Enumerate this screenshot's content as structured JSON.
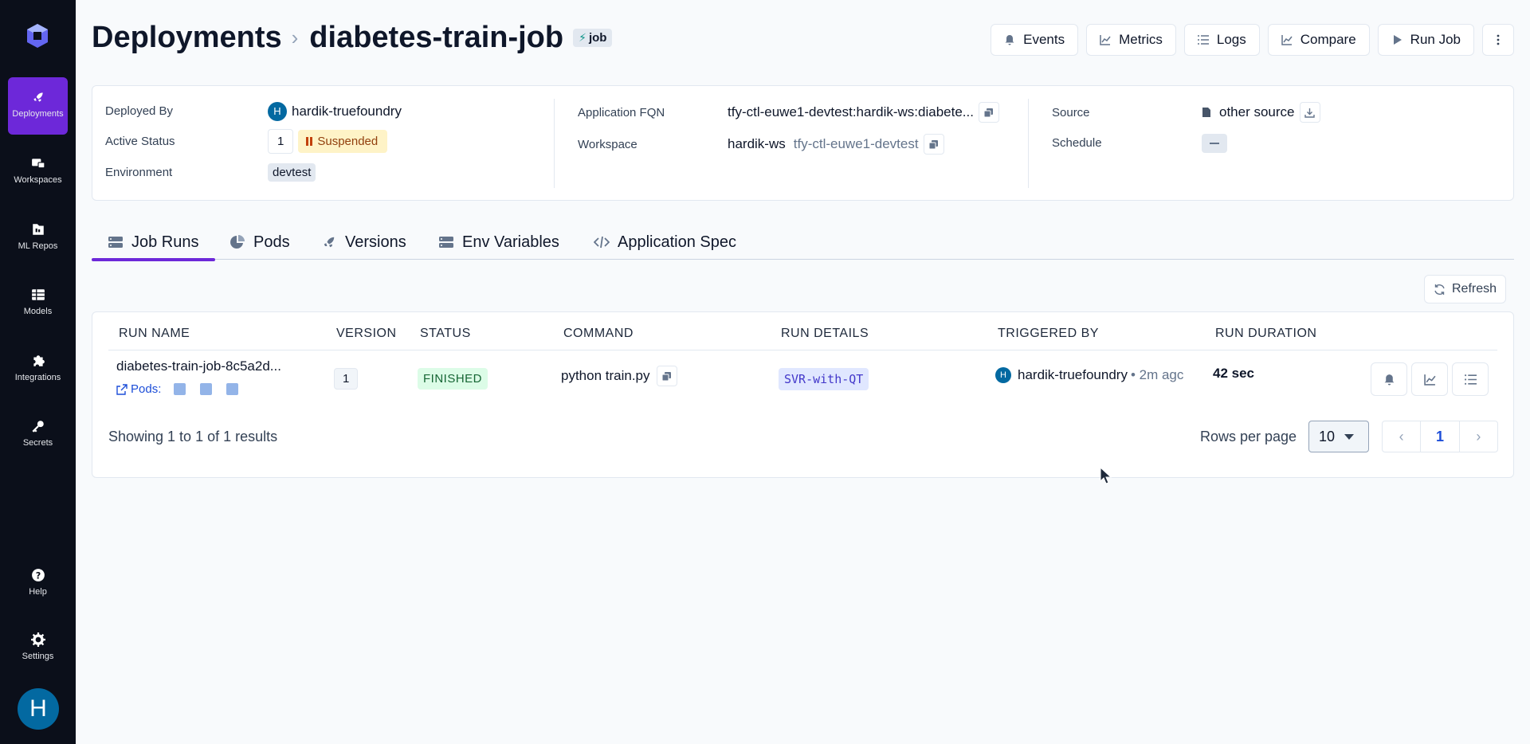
{
  "sidebar": {
    "items": [
      {
        "label": "Deployments",
        "icon": "rocket-icon"
      },
      {
        "label": "Workspaces",
        "icon": "workspaces-icon"
      },
      {
        "label": "ML Repos",
        "icon": "ml-repos-icon"
      },
      {
        "label": "Models",
        "icon": "models-icon"
      },
      {
        "label": "Integrations",
        "icon": "puzzle-icon"
      },
      {
        "label": "Secrets",
        "icon": "key-icon"
      },
      {
        "label": "Help",
        "icon": "help-icon"
      },
      {
        "label": "Settings",
        "icon": "gear-icon"
      }
    ],
    "avatar_initial": "H"
  },
  "header": {
    "breadcrumb_root": "Deployments",
    "breadcrumb_current": "diabetes-train-job",
    "type_badge": "job",
    "buttons": {
      "events": "Events",
      "metrics": "Metrics",
      "logs": "Logs",
      "compare": "Compare",
      "run_job": "Run Job"
    }
  },
  "info": {
    "deployed_by_label": "Deployed By",
    "deployed_by_initial": "H",
    "deployed_by_value": "hardik-truefoundry",
    "active_status_label": "Active Status",
    "active_count": "1",
    "active_status_value": "Suspended",
    "environment_label": "Environment",
    "environment_value": "devtest",
    "fqn_label": "Application FQN",
    "fqn_value": "tfy-ctl-euwe1-devtest:hardik-ws:diabete...",
    "workspace_label": "Workspace",
    "workspace_value": "hardik-ws",
    "workspace_cluster": "tfy-ctl-euwe1-devtest",
    "source_label": "Source",
    "source_value": "other source",
    "schedule_label": "Schedule"
  },
  "tabs": [
    {
      "label": "Job Runs"
    },
    {
      "label": "Pods"
    },
    {
      "label": "Versions"
    },
    {
      "label": "Env Variables"
    },
    {
      "label": "Application Spec"
    }
  ],
  "refresh_label": "Refresh",
  "table": {
    "columns": [
      "RUN NAME",
      "VERSION",
      "STATUS",
      "COMMAND",
      "RUN DETAILS",
      "TRIGGERED BY",
      "RUN DURATION"
    ],
    "rows": [
      {
        "run_name": "diabetes-train-job-8c5a2d...",
        "pods_label": "Pods:",
        "version": "1",
        "status": "FINISHED",
        "command": "python train.py",
        "run_details": "SVR-with-QT",
        "triggered_initial": "H",
        "triggered_by": "hardik-truefoundry",
        "triggered_time": "• 2m agc",
        "duration": "42 sec"
      }
    ]
  },
  "footer": {
    "showing": "Showing 1 to 1 of 1 results",
    "rows_per_page_label": "Rows per page",
    "rows_per_page_value": "10",
    "current_page": "1"
  }
}
